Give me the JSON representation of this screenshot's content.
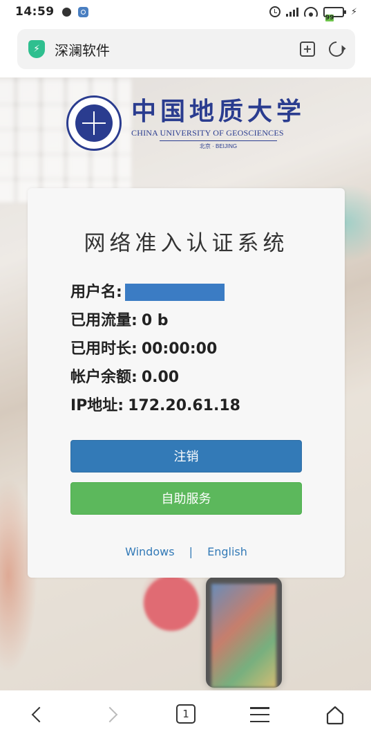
{
  "status_bar": {
    "time": "14:59",
    "battery": "99"
  },
  "browser": {
    "address_text": "深澜软件",
    "tab_count": "1"
  },
  "logo": {
    "chinese_name": "中国地质大学",
    "english_name": "CHINA UNIVERSITY OF GEOSCIENCES",
    "city": "北京 · BEIJING"
  },
  "card": {
    "title": "网络准入认证系统",
    "fields": {
      "username_label": "用户名:",
      "traffic_label": "已用流量:",
      "traffic_value": "0 b",
      "duration_label": "已用时长:",
      "duration_value": "00:00:00",
      "balance_label": "帐户余额:",
      "balance_value": "0.00",
      "ip_label": "IP地址:",
      "ip_value": "172.20.61.18"
    },
    "logout_label": "注销",
    "self_service_label": "自助服务",
    "link_windows": "Windows",
    "link_separator": "|",
    "link_english": "English"
  },
  "colors": {
    "primary": "#337ab7",
    "success": "#5cb85c",
    "logo_blue": "#2a3c8f"
  }
}
